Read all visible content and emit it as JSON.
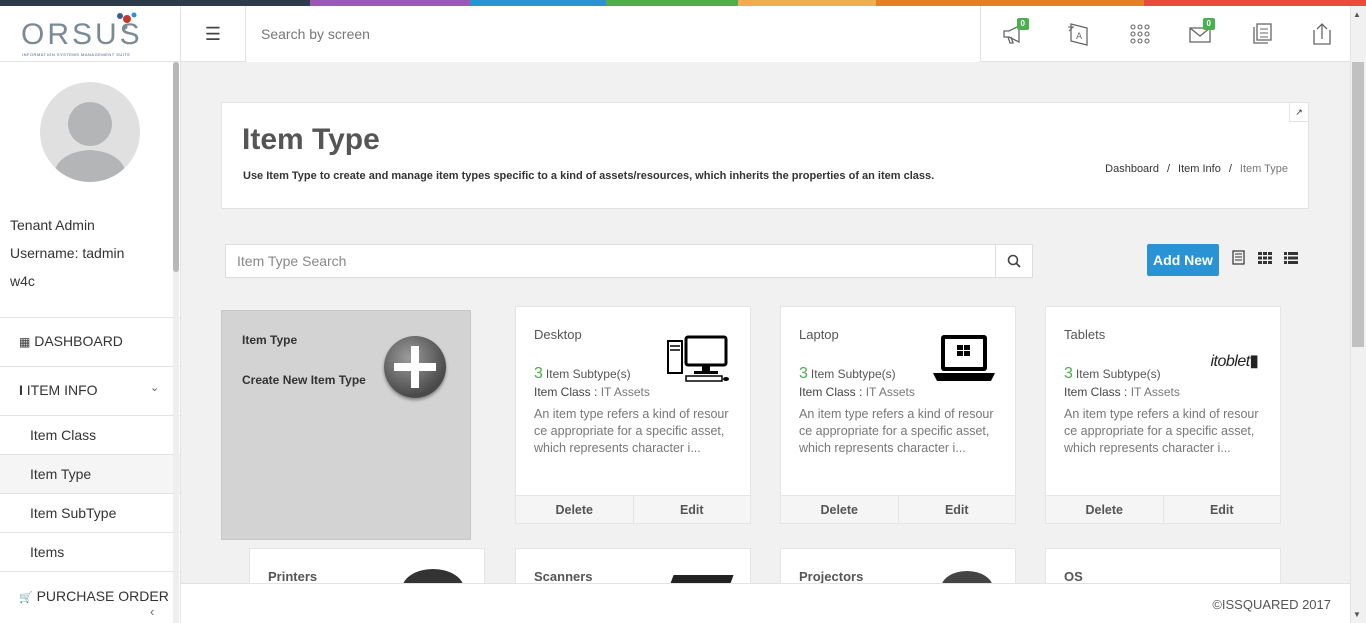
{
  "header": {
    "logo_text": "ORSUS",
    "logo_sub": "INFORMATION SYSTEMS MANAGEMENT SUITE",
    "search_placeholder": "Search by screen",
    "notifications_badge": "0",
    "messages_badge": "0",
    "strip_colors": [
      "#2d3a4a",
      "#9b59b6",
      "#2a93d5",
      "#4cae4c",
      "#f0ad4e",
      "#e67e22",
      "#e74c3c"
    ]
  },
  "sidebar": {
    "user_role": "Tenant Admin",
    "username": "Username: tadmin",
    "tenant": "w4c",
    "items": [
      {
        "label": "DASHBOARD"
      },
      {
        "label": "ITEM INFO"
      },
      {
        "label": "Item Class"
      },
      {
        "label": "Item Type"
      },
      {
        "label": "Item SubType"
      },
      {
        "label": "Items"
      },
      {
        "label": "PURCHASE ORDER"
      }
    ]
  },
  "title_card": {
    "title": "Item Type",
    "description": "Use Item Type to create and manage item types specific to a kind of assets/resources, which inherits the properties of an item class.",
    "breadcrumb": [
      "Dashboard",
      "Item Info",
      "Item Type"
    ]
  },
  "toolbar": {
    "search_placeholder": "Item Type Search",
    "add_new_label": "Add New"
  },
  "new_card": {
    "title": "Item Type",
    "action": "Create New Item Type"
  },
  "cards": [
    {
      "name": "Desktop",
      "count": "3",
      "count_label": "Item Subtype(s)",
      "class_label": "Item Class :",
      "class_value": "IT Assets",
      "description": "An item type refers a kind of resource appropriate for a specific asset, which represents character i...",
      "delete_label": "Delete",
      "edit_label": "Edit",
      "icon": "desktop-icon"
    },
    {
      "name": "Laptop",
      "count": "3",
      "count_label": "Item Subtype(s)",
      "class_label": "Item Class :",
      "class_value": "IT Assets",
      "description": "An item type refers a kind of resource appropriate for a specific asset, which represents character i...",
      "delete_label": "Delete",
      "edit_label": "Edit",
      "icon": "laptop-icon"
    },
    {
      "name": "Tablets",
      "count": "3",
      "count_label": "Item Subtype(s)",
      "class_label": "Item Class :",
      "class_value": "IT Assets",
      "description": "An item type refers a kind of resource appropriate for a specific asset, which represents character i...",
      "delete_label": "Delete",
      "edit_label": "Edit",
      "icon": "tablet-logo",
      "logo_text": "itoblet"
    }
  ],
  "partial_cards": [
    {
      "name": "Printers"
    },
    {
      "name": "Scanners"
    },
    {
      "name": "Projectors"
    },
    {
      "name": "OS"
    }
  ],
  "footer": {
    "copyright": "©ISSQUARED 2017"
  }
}
